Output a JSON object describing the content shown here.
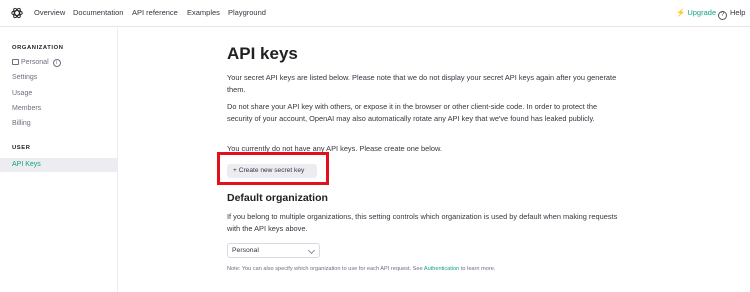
{
  "nav": {
    "links": [
      "Overview",
      "Documentation",
      "API reference",
      "Examples",
      "Playground"
    ],
    "upgrade_label": "Upgrade",
    "help_label": "Help"
  },
  "sidebar": {
    "org_heading": "ORGANIZATION",
    "org_name": "Personal",
    "org_items": [
      "Settings",
      "Usage",
      "Members",
      "Billing"
    ],
    "user_heading": "USER",
    "user_items": [
      "API Keys"
    ]
  },
  "main": {
    "title": "API keys",
    "para1": "Your secret API keys are listed below. Please note that we do not display your secret API keys again after you generate them.",
    "para2": "Do not share your API key with others, or expose it in the browser or other client-side code. In order to protect the security of your account, OpenAI may also automatically rotate any API key that we've found has leaked publicly.",
    "para3": "You currently do not have any API keys. Please create one below.",
    "create_button": "Create new secret key",
    "default_org_heading": "Default organization",
    "default_org_desc": "If you belong to multiple organizations, this setting controls which organization is used by default when making requests with the API keys above.",
    "org_select_value": "Personal",
    "note_prefix": "Note: You can also specify which organization to use for each API request. See ",
    "note_link": "Authentication",
    "note_suffix": " to learn more."
  },
  "colors": {
    "accent": "#10a37f",
    "highlight_box": "#e3101b"
  },
  "icons": {
    "logo": "openai-logo-icon",
    "upgrade": "bolt-icon",
    "help": "help-circle-icon",
    "org": "building-icon",
    "info": "info-icon",
    "plus": "plus-icon",
    "select": "chevron-down-icon"
  }
}
